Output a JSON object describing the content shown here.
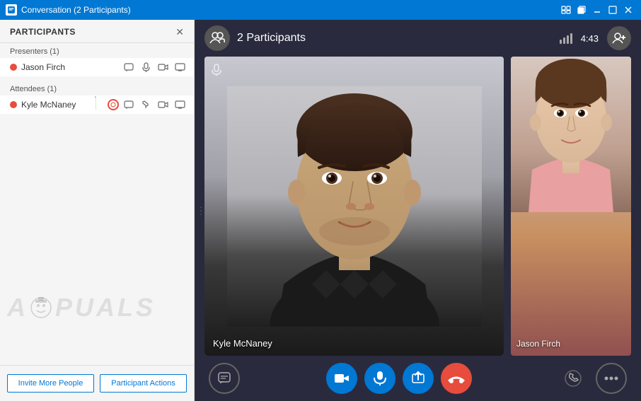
{
  "titleBar": {
    "icon": "💬",
    "title": "Conversation (2 Participants)",
    "controls": {
      "restore": "❐",
      "minimize": "─",
      "maximize": "□",
      "close": "✕"
    }
  },
  "sidebar": {
    "header": "PARTICIPANTS",
    "closeLabel": "✕",
    "presenters": {
      "sectionLabel": "Presenters (1)",
      "items": [
        {
          "name": "Jason Firch",
          "dotColor": "#e74c3c"
        }
      ]
    },
    "attendees": {
      "sectionLabel": "Attendees (1)",
      "items": [
        {
          "name": "Kyle McNaney",
          "dotColor": "#e74c3c"
        }
      ]
    },
    "footer": {
      "inviteLabel": "Invite More People",
      "actionsLabel": "Participant Actions"
    }
  },
  "videoArea": {
    "participantsCount": "2 Participants",
    "signal": "📶",
    "time": "4:43",
    "mainVideo": {
      "name": "Kyle McNaney"
    },
    "secondaryVideo": {
      "name": "Jason Firch"
    },
    "controls": {
      "chat": "💬",
      "video": "🎥",
      "mic": "🎤",
      "share": "↑",
      "end": "📞",
      "phone": "📞",
      "more": "•••"
    }
  },
  "watermark": "APPUALS"
}
